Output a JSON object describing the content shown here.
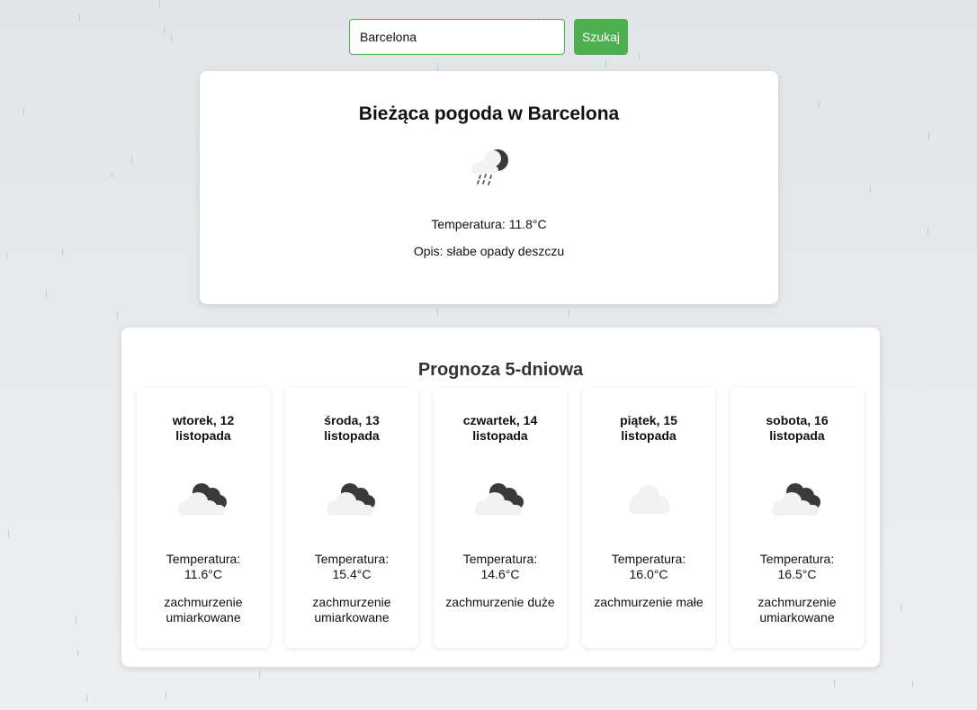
{
  "search": {
    "value": "Barcelona",
    "button_label": "Szukaj"
  },
  "current": {
    "title": "Bieżąca pogoda w Barcelona",
    "icon": "light-rain-night-icon",
    "temperature_label": "Temperatura:",
    "temperature": "11.8°C",
    "description_label": "Opis:",
    "description": "słabe opady deszczu"
  },
  "forecast": {
    "title": "Prognoza 5-dniowa",
    "temperature_label": "Temperatura:",
    "days": [
      {
        "date": "wtorek, 12 listopada",
        "temperature": "11.6°C",
        "description": "zachmurzenie umiarkowane",
        "icon": "broken-clouds-icon"
      },
      {
        "date": "środa, 13 listopada",
        "temperature": "15.4°C",
        "description": "zachmurzenie umiarkowane",
        "icon": "broken-clouds-icon"
      },
      {
        "date": "czwartek, 14 listopada",
        "temperature": "14.6°C",
        "description": "zachmurzenie duże",
        "icon": "broken-clouds-icon"
      },
      {
        "date": "piątek, 15 listopada",
        "temperature": "16.0°C",
        "description": "zachmurzenie małe",
        "icon": "cloud-icon"
      },
      {
        "date": "sobota, 16 listopada",
        "temperature": "16.5°C",
        "description": "zachmurzenie umiarkowane",
        "icon": "broken-clouds-icon"
      }
    ]
  },
  "colors": {
    "accent": "#4caf50",
    "rain": "#8fd4d6",
    "background": "#e2e5e8"
  }
}
